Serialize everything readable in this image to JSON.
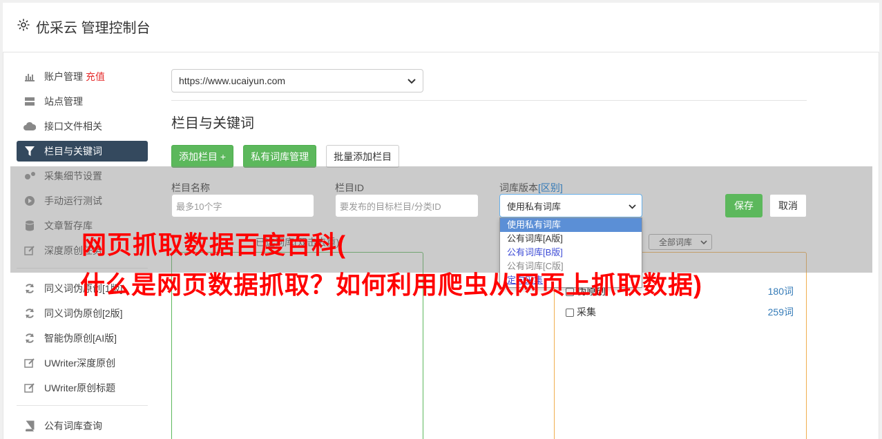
{
  "app": {
    "title": "优采云 管理控制台"
  },
  "sidebar": {
    "items": [
      {
        "label": "账户管理",
        "badge": "充值",
        "icon": "bar-chart-icon"
      },
      {
        "label": "站点管理",
        "icon": "server-icon"
      },
      {
        "label": "接口文件相关",
        "icon": "cloud-upload-icon"
      },
      {
        "label": "栏目与关键词",
        "icon": "filter-icon",
        "active": true
      },
      {
        "label": "采集细节设置",
        "icon": "gears-icon"
      },
      {
        "label": "手动运行测试",
        "icon": "play-circle-icon"
      },
      {
        "label": "文章暂存库",
        "icon": "database-icon"
      },
      {
        "label": "深度原创任务",
        "icon": "edit-icon"
      }
    ],
    "items2": [
      {
        "label": "同义词伪原创[1版]",
        "icon": "refresh-icon"
      },
      {
        "label": "同义词伪原创[2版]",
        "icon": "refresh-icon"
      },
      {
        "label": "智能伪原创[AI版]",
        "icon": "refresh-icon"
      },
      {
        "label": "UWriter深度原创",
        "icon": "edit-icon"
      },
      {
        "label": "UWriter原创标题",
        "icon": "edit-icon"
      }
    ],
    "items3": [
      {
        "label": "公有词库查询",
        "icon": "book-icon"
      }
    ]
  },
  "main": {
    "site_select": "https://www.ucaiyun.com",
    "section_title": "栏目与关键词",
    "buttons": {
      "add_column": "添加栏目 +",
      "private_lib": "私有词库管理",
      "batch_add": "批量添加栏目"
    }
  },
  "form": {
    "name_label": "栏目名称",
    "name_placeholder": "最多10个字",
    "id_label": "栏目ID",
    "id_placeholder": "要发布的目标栏目/分类ID",
    "dict_label": "词库版本",
    "dict_label_link": "[区别]",
    "dict_selected": "使用私有词库",
    "save": "保存",
    "cancel": "取消",
    "dict_options": [
      "使用私有词库",
      "公有词库[A版]",
      "公有词库[B版]",
      "公有词库[C版]",
      "定向采集"
    ]
  },
  "panels": {
    "selected_label": "已选词库(双击去重)",
    "filter_select": "全部词库",
    "libraries": [
      {
        "name": "伪原创",
        "count": "180词"
      },
      {
        "name": "采集",
        "count": "259词"
      }
    ]
  },
  "overlay_title": {
    "line1": "网页抓取数据百度百科(",
    "line2": "什么是网页数据抓取？如何利用爬虫从网页上抓取数据)"
  },
  "colors": {
    "accent_green": "#5cb85c",
    "nav_active": "#34495e",
    "overlay_red": "#ff0000",
    "link_blue": "#337ab7"
  }
}
